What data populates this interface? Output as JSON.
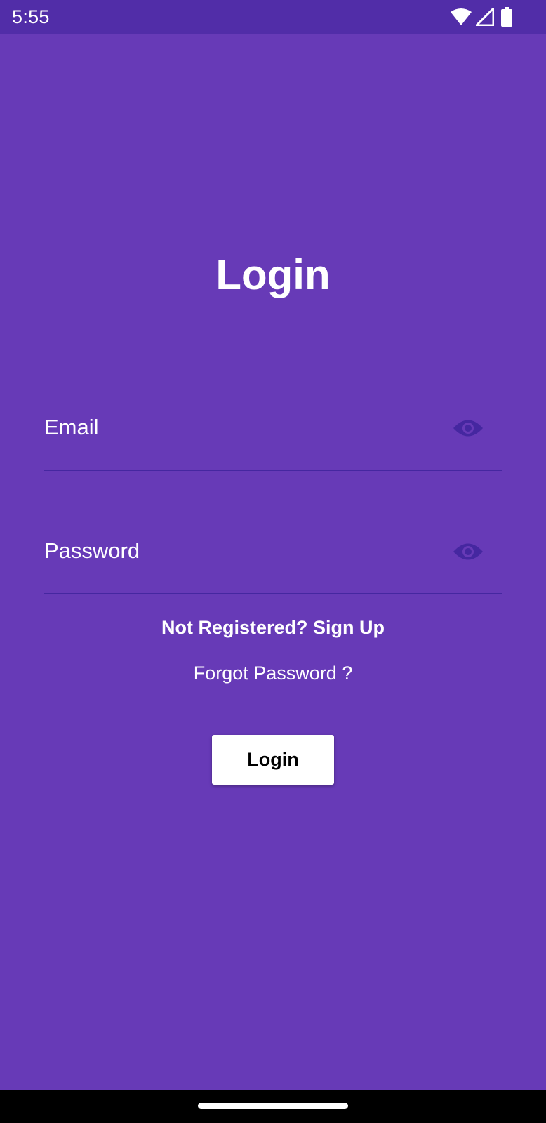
{
  "status_bar": {
    "time": "5:55",
    "icons": [
      "wifi-icon",
      "signal-icon",
      "battery-icon"
    ]
  },
  "login": {
    "title": "Login",
    "email_label": "Email",
    "password_label": "Password",
    "signup_link": "Not Registered? Sign Up",
    "forgot_link": "Forgot Password ?",
    "button_label": "Login"
  },
  "colors": {
    "background": "#673AB7",
    "status_bar": "#512DA8",
    "underline": "#4527A0",
    "eye_icon": "#4527A0",
    "button": "#FFFFFF"
  }
}
